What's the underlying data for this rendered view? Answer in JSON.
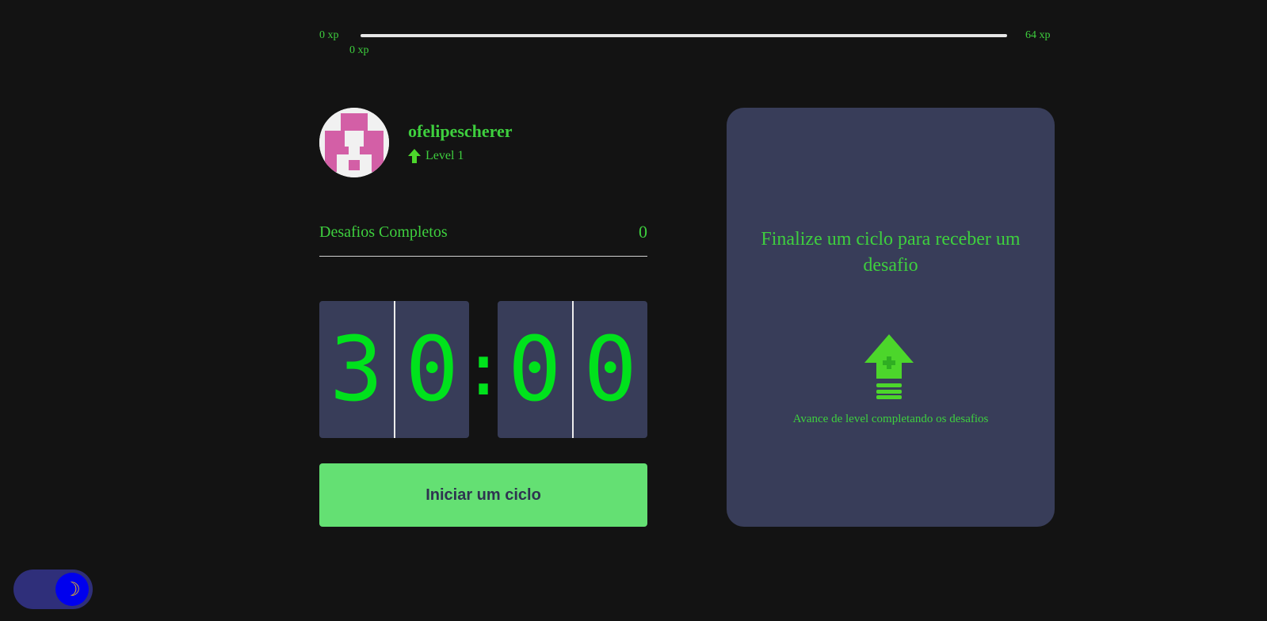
{
  "experience": {
    "min_label": "0 xp",
    "max_label": "64 xp",
    "current_label": "0 xp",
    "progress": 0,
    "colors": {
      "track": "#e6e6e6",
      "fill": "#4cd62b"
    }
  },
  "profile": {
    "username": "ofelipescherer",
    "level_label": "Level 1",
    "level_icon": "level-up-arrow-icon",
    "avatar_icon": "pixel-avatar-icon"
  },
  "challenges": {
    "label": "Desafios Completos",
    "count": "0"
  },
  "countdown": {
    "minutes": [
      "3",
      "0"
    ],
    "seconds": [
      "0",
      "0"
    ],
    "separator": ":"
  },
  "start_button": {
    "label": "Iniciar um ciclo"
  },
  "challenge_panel": {
    "title": "Finalize um ciclo para receber um desafio",
    "icon": "level-up-icon",
    "hint": "Avance de level completando os desafios"
  },
  "theme_toggle": {
    "icon": "moon-icon",
    "glyph": "☽"
  },
  "colors": {
    "background": "#131313",
    "accent_green": "#3ecf3e",
    "digit_green": "#00e21c",
    "card": "#383d59",
    "button": "#64e073"
  }
}
